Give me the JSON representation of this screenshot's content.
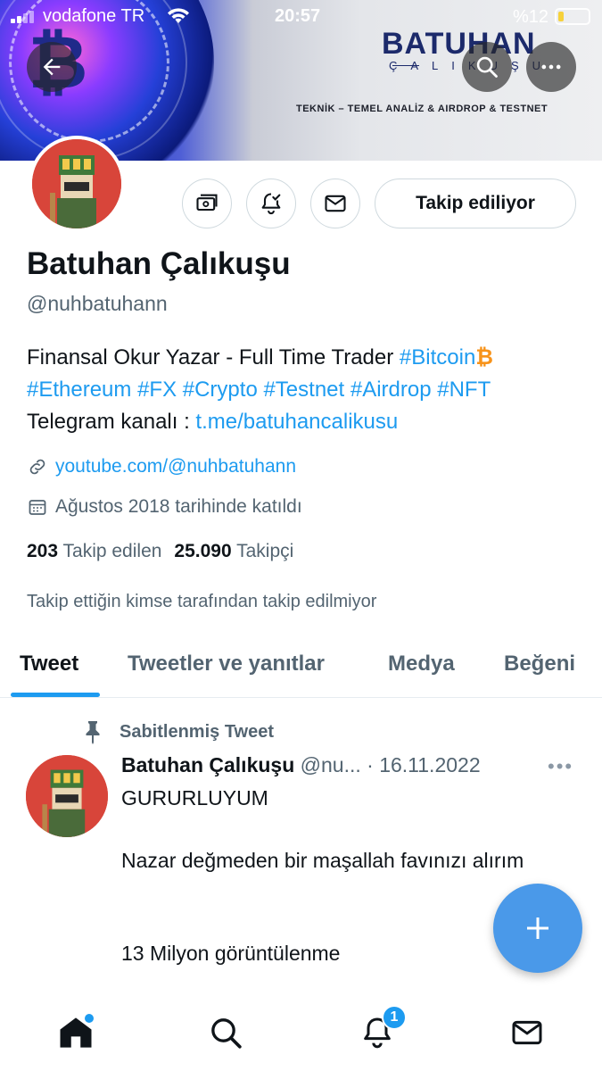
{
  "status_bar": {
    "carrier": "vodafone TR",
    "time": "20:57",
    "battery": "%12"
  },
  "banner": {
    "brand_title": "BATUHAN",
    "brand_subtitle": "ÇALIKUŞU",
    "tagline": "TEKNİK – TEMEL ANALİZ & AIRDROP & TESTNET"
  },
  "profile": {
    "follow_button": "Takip ediliyor",
    "display_name": "Batuhan Çalıkuşu",
    "handle": "@nuhbatuhann",
    "bio": {
      "line1_text": "Finansal Okur Yazar - Full Time Trader ",
      "line1_tag": "#Bitcoin",
      "line2_tags": "#Ethereum #FX #Crypto #Testnet #Airdrop #NFT",
      "line3_label": "Telegram kanalı : ",
      "line3_link": "t.me/batuhancalikusu"
    },
    "website": "youtube.com/@nuhbatuhann",
    "joined": "Ağustos 2018 tarihinde katıldı",
    "following_count": "203",
    "following_label": "Takip edilen",
    "followers_count": "25.090",
    "followers_label": "Takipçi",
    "not_followed_note": "Takip ettiğin kimse tarafından takip edilmiyor"
  },
  "tabs": [
    {
      "label": "Tweet",
      "active": true
    },
    {
      "label": "Tweetler ve yanıtlar",
      "active": false
    },
    {
      "label": "Medya",
      "active": false
    },
    {
      "label": "Beğeni",
      "active": false
    }
  ],
  "tweet": {
    "pinned_label": "Sabitlenmiş Tweet",
    "author_name": "Batuhan Çalıkuşu",
    "author_handle": "@nu...",
    "date": "· 16.11.2022",
    "more": "•••",
    "line1": "GURURLUYUM",
    "line2": "Nazar değmeden bir maşallah favınızı alırım",
    "line3": "13 Milyon görüntülenme"
  },
  "bottom_nav": {
    "notification_badge": "1",
    "items": [
      "home-icon",
      "search-icon",
      "bell-icon",
      "mail-icon"
    ]
  },
  "colors": {
    "accent": "#1d9bf0",
    "text": "#0f1419",
    "muted": "#536471",
    "fab": "#4a99e9",
    "bitcoin": "#f7931a"
  }
}
